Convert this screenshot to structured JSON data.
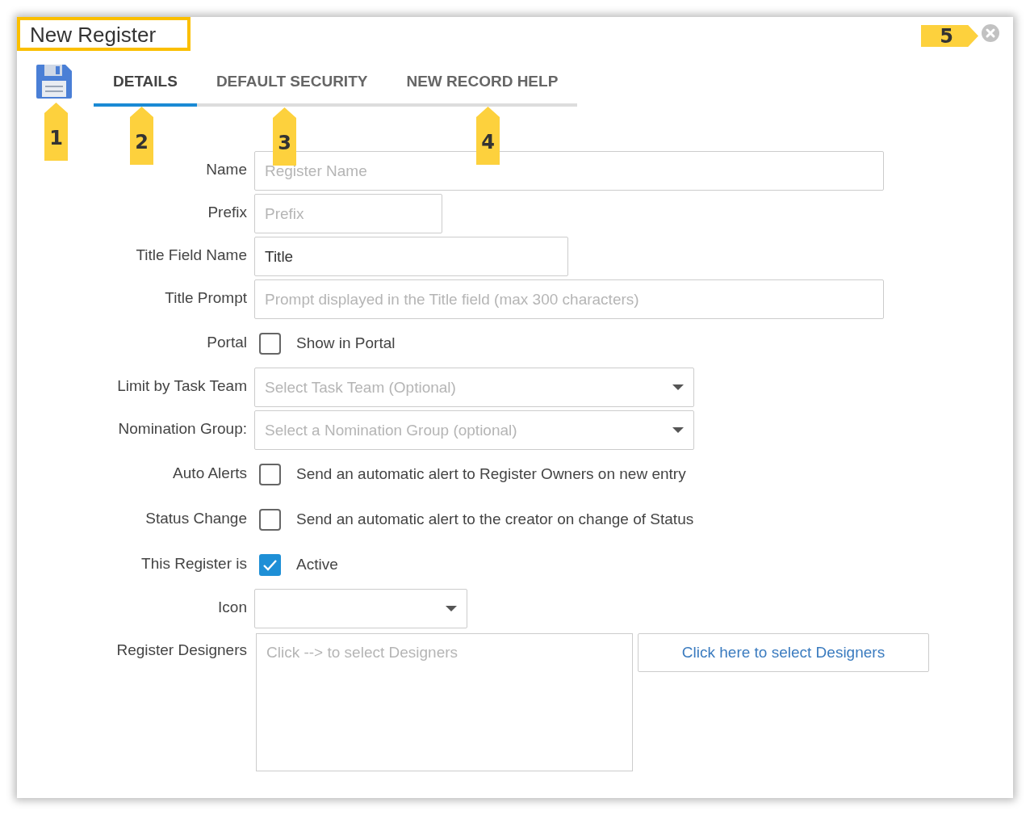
{
  "window": {
    "title": "New Register"
  },
  "tabs": [
    {
      "label": "DETAILS",
      "selected": true
    },
    {
      "label": "DEFAULT SECURITY",
      "selected": false
    },
    {
      "label": "NEW RECORD HELP",
      "selected": false
    }
  ],
  "fields": [
    {
      "kind": "text",
      "label": "Name",
      "placeholder": "Register Name"
    },
    {
      "kind": "text",
      "label": "Prefix",
      "placeholder": "Prefix"
    },
    {
      "kind": "text",
      "label": "Title Field Name",
      "value": "Title"
    },
    {
      "kind": "text",
      "label": "Title Prompt",
      "placeholder": "Prompt displayed in the Title field (max 300 characters)"
    },
    {
      "kind": "checkbox",
      "label": "Portal",
      "text": "Show in Portal",
      "checked": false
    },
    {
      "kind": "select",
      "label": "Limit by Task Team",
      "placeholder": "Select Task Team (Optional)"
    },
    {
      "kind": "select",
      "label": "Nomination Group:",
      "placeholder": "Select a Nomination Group (optional)"
    },
    {
      "kind": "checkbox",
      "label": "Auto Alerts",
      "text": "Send an automatic alert to Register Owners on new entry",
      "checked": false
    },
    {
      "kind": "checkbox",
      "label": "Status Change",
      "text": "Send an automatic alert to the creator on change of Status",
      "checked": false
    },
    {
      "kind": "checkbox",
      "label": "This Register is",
      "text": "Active",
      "checked": true
    },
    {
      "kind": "select",
      "label": "Icon"
    },
    {
      "kind": "designers",
      "label": "Register Designers",
      "placeholder": "Click --> to select Designers",
      "button": "Click here to select Designers"
    }
  ],
  "callouts": [
    {
      "number": "1",
      "kind": "up"
    },
    {
      "number": "2",
      "kind": "up"
    },
    {
      "number": "3",
      "kind": "up"
    },
    {
      "number": "4",
      "kind": "up"
    },
    {
      "number": "5",
      "kind": "right"
    }
  ]
}
